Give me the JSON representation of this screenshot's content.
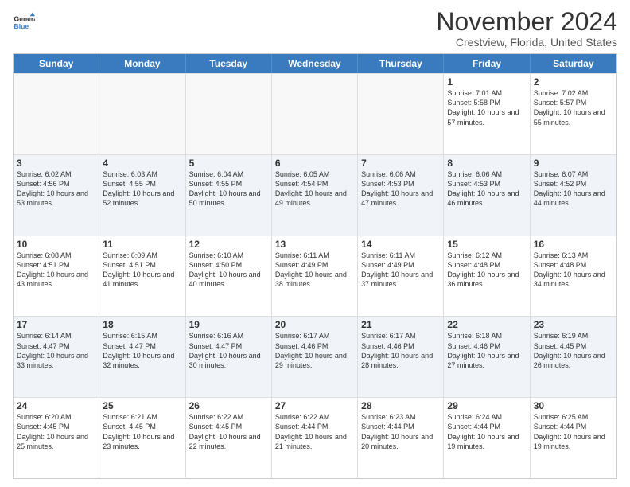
{
  "header": {
    "logo_general": "General",
    "logo_blue": "Blue",
    "title": "November 2024",
    "subtitle": "Crestview, Florida, United States"
  },
  "calendar": {
    "days_of_week": [
      "Sunday",
      "Monday",
      "Tuesday",
      "Wednesday",
      "Thursday",
      "Friday",
      "Saturday"
    ],
    "weeks": [
      [
        {
          "day": "",
          "empty": true
        },
        {
          "day": "",
          "empty": true
        },
        {
          "day": "",
          "empty": true
        },
        {
          "day": "",
          "empty": true
        },
        {
          "day": "",
          "empty": true
        },
        {
          "day": "1",
          "sunrise": "Sunrise: 7:01 AM",
          "sunset": "Sunset: 5:58 PM",
          "daylight": "Daylight: 10 hours and 57 minutes."
        },
        {
          "day": "2",
          "sunrise": "Sunrise: 7:02 AM",
          "sunset": "Sunset: 5:57 PM",
          "daylight": "Daylight: 10 hours and 55 minutes."
        }
      ],
      [
        {
          "day": "3",
          "sunrise": "Sunrise: 6:02 AM",
          "sunset": "Sunset: 4:56 PM",
          "daylight": "Daylight: 10 hours and 53 minutes."
        },
        {
          "day": "4",
          "sunrise": "Sunrise: 6:03 AM",
          "sunset": "Sunset: 4:55 PM",
          "daylight": "Daylight: 10 hours and 52 minutes."
        },
        {
          "day": "5",
          "sunrise": "Sunrise: 6:04 AM",
          "sunset": "Sunset: 4:55 PM",
          "daylight": "Daylight: 10 hours and 50 minutes."
        },
        {
          "day": "6",
          "sunrise": "Sunrise: 6:05 AM",
          "sunset": "Sunset: 4:54 PM",
          "daylight": "Daylight: 10 hours and 49 minutes."
        },
        {
          "day": "7",
          "sunrise": "Sunrise: 6:06 AM",
          "sunset": "Sunset: 4:53 PM",
          "daylight": "Daylight: 10 hours and 47 minutes."
        },
        {
          "day": "8",
          "sunrise": "Sunrise: 6:06 AM",
          "sunset": "Sunset: 4:53 PM",
          "daylight": "Daylight: 10 hours and 46 minutes."
        },
        {
          "day": "9",
          "sunrise": "Sunrise: 6:07 AM",
          "sunset": "Sunset: 4:52 PM",
          "daylight": "Daylight: 10 hours and 44 minutes."
        }
      ],
      [
        {
          "day": "10",
          "sunrise": "Sunrise: 6:08 AM",
          "sunset": "Sunset: 4:51 PM",
          "daylight": "Daylight: 10 hours and 43 minutes."
        },
        {
          "day": "11",
          "sunrise": "Sunrise: 6:09 AM",
          "sunset": "Sunset: 4:51 PM",
          "daylight": "Daylight: 10 hours and 41 minutes."
        },
        {
          "day": "12",
          "sunrise": "Sunrise: 6:10 AM",
          "sunset": "Sunset: 4:50 PM",
          "daylight": "Daylight: 10 hours and 40 minutes."
        },
        {
          "day": "13",
          "sunrise": "Sunrise: 6:11 AM",
          "sunset": "Sunset: 4:49 PM",
          "daylight": "Daylight: 10 hours and 38 minutes."
        },
        {
          "day": "14",
          "sunrise": "Sunrise: 6:11 AM",
          "sunset": "Sunset: 4:49 PM",
          "daylight": "Daylight: 10 hours and 37 minutes."
        },
        {
          "day": "15",
          "sunrise": "Sunrise: 6:12 AM",
          "sunset": "Sunset: 4:48 PM",
          "daylight": "Daylight: 10 hours and 36 minutes."
        },
        {
          "day": "16",
          "sunrise": "Sunrise: 6:13 AM",
          "sunset": "Sunset: 4:48 PM",
          "daylight": "Daylight: 10 hours and 34 minutes."
        }
      ],
      [
        {
          "day": "17",
          "sunrise": "Sunrise: 6:14 AM",
          "sunset": "Sunset: 4:47 PM",
          "daylight": "Daylight: 10 hours and 33 minutes."
        },
        {
          "day": "18",
          "sunrise": "Sunrise: 6:15 AM",
          "sunset": "Sunset: 4:47 PM",
          "daylight": "Daylight: 10 hours and 32 minutes."
        },
        {
          "day": "19",
          "sunrise": "Sunrise: 6:16 AM",
          "sunset": "Sunset: 4:47 PM",
          "daylight": "Daylight: 10 hours and 30 minutes."
        },
        {
          "day": "20",
          "sunrise": "Sunrise: 6:17 AM",
          "sunset": "Sunset: 4:46 PM",
          "daylight": "Daylight: 10 hours and 29 minutes."
        },
        {
          "day": "21",
          "sunrise": "Sunrise: 6:17 AM",
          "sunset": "Sunset: 4:46 PM",
          "daylight": "Daylight: 10 hours and 28 minutes."
        },
        {
          "day": "22",
          "sunrise": "Sunrise: 6:18 AM",
          "sunset": "Sunset: 4:46 PM",
          "daylight": "Daylight: 10 hours and 27 minutes."
        },
        {
          "day": "23",
          "sunrise": "Sunrise: 6:19 AM",
          "sunset": "Sunset: 4:45 PM",
          "daylight": "Daylight: 10 hours and 26 minutes."
        }
      ],
      [
        {
          "day": "24",
          "sunrise": "Sunrise: 6:20 AM",
          "sunset": "Sunset: 4:45 PM",
          "daylight": "Daylight: 10 hours and 25 minutes."
        },
        {
          "day": "25",
          "sunrise": "Sunrise: 6:21 AM",
          "sunset": "Sunset: 4:45 PM",
          "daylight": "Daylight: 10 hours and 23 minutes."
        },
        {
          "day": "26",
          "sunrise": "Sunrise: 6:22 AM",
          "sunset": "Sunset: 4:45 PM",
          "daylight": "Daylight: 10 hours and 22 minutes."
        },
        {
          "day": "27",
          "sunrise": "Sunrise: 6:22 AM",
          "sunset": "Sunset: 4:44 PM",
          "daylight": "Daylight: 10 hours and 21 minutes."
        },
        {
          "day": "28",
          "sunrise": "Sunrise: 6:23 AM",
          "sunset": "Sunset: 4:44 PM",
          "daylight": "Daylight: 10 hours and 20 minutes."
        },
        {
          "day": "29",
          "sunrise": "Sunrise: 6:24 AM",
          "sunset": "Sunset: 4:44 PM",
          "daylight": "Daylight: 10 hours and 19 minutes."
        },
        {
          "day": "30",
          "sunrise": "Sunrise: 6:25 AM",
          "sunset": "Sunset: 4:44 PM",
          "daylight": "Daylight: 10 hours and 19 minutes."
        }
      ]
    ]
  }
}
